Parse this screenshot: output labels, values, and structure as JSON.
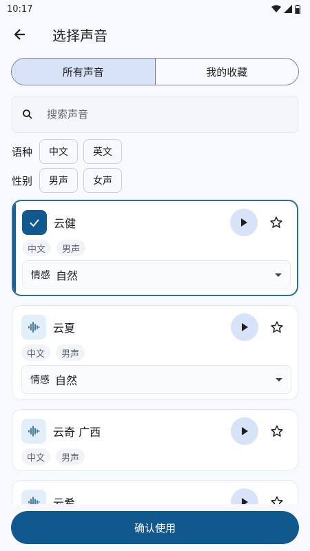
{
  "status": {
    "time": "10:17"
  },
  "header": {
    "title": "选择声音"
  },
  "tabs": [
    {
      "label": "所有声音",
      "active": true
    },
    {
      "label": "我的收藏",
      "active": false
    }
  ],
  "search": {
    "placeholder": "搜索声音",
    "value": ""
  },
  "filters": {
    "language": {
      "label": "语种",
      "options": [
        "中文",
        "英文"
      ]
    },
    "gender": {
      "label": "性别",
      "options": [
        "男声",
        "女声"
      ]
    }
  },
  "voices": [
    {
      "name": "云健",
      "tags": [
        "中文",
        "男声"
      ],
      "selected": true,
      "emotion_label": "情感",
      "emotion_value": "自然"
    },
    {
      "name": "云夏",
      "tags": [
        "中文",
        "男声"
      ],
      "selected": false,
      "emotion_label": "情感",
      "emotion_value": "自然"
    },
    {
      "name": "云奇 广西",
      "tags": [
        "中文",
        "男声"
      ],
      "selected": false
    },
    {
      "name": "云希",
      "selected": false
    }
  ],
  "footer": {
    "confirm_label": "确认使用"
  },
  "colors": {
    "primary": "#11588f",
    "accent_bg": "#d7e3f7",
    "selected_border": "#2a6f94"
  }
}
